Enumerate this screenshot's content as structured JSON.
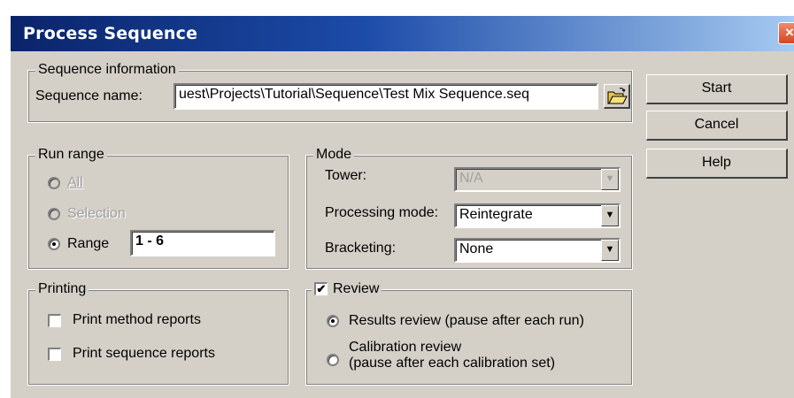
{
  "window": {
    "title": "Process Sequence",
    "close_glyph": "×"
  },
  "sequence_info": {
    "legend": "Sequence information",
    "name_label": "Sequence name:",
    "name_value": "uest\\Projects\\Tutorial\\Sequence\\Test Mix Sequence.seq",
    "browse_icon": "folder-open-icon"
  },
  "run_range": {
    "legend": "Run range",
    "options": [
      {
        "label": "All",
        "enabled": false,
        "selected": false
      },
      {
        "label": "Selection",
        "enabled": false,
        "selected": false
      },
      {
        "label": "Range",
        "enabled": true,
        "selected": true
      }
    ],
    "range_value": "1 - 6"
  },
  "mode": {
    "legend": "Mode",
    "tower_label": "Tower:",
    "tower_value": "N/A",
    "processing_label": "Processing mode:",
    "processing_value": "Reintegrate",
    "bracketing_label": "Bracketing:",
    "bracketing_value": "None"
  },
  "printing": {
    "legend": "Printing",
    "method_reports": "Print method reports",
    "sequence_reports": "Print sequence reports",
    "method_checked": false,
    "sequence_checked": false
  },
  "review": {
    "legend": "Review",
    "checked": true,
    "check_glyph": "✔",
    "results_label": "Results review (pause after each run)",
    "calibration_line1": "Calibration review",
    "calibration_line2": "(pause after each calibration set)",
    "selected": "results"
  },
  "buttons": {
    "start": "Start",
    "cancel": "Cancel",
    "help": "Help"
  },
  "colors": {
    "titlebar_start": "#0a246a",
    "titlebar_end": "#a6caf0",
    "dialog_bg": "#d4d0c8",
    "close_btn": "#d4451f"
  }
}
